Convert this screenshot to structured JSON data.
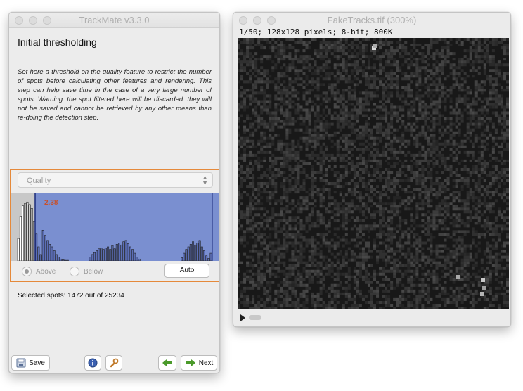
{
  "trackmate": {
    "title": "TrackMate v3.3.0",
    "heading": "Initial thresholding",
    "description": "Set here a threshold on the quality feature to restrict the number of spots before calculating other features and rendering. This step can help save time in the case of a very large number of spots.",
    "warning": "Warning: the spot filtered here will be discarded: they will not be saved and cannot be retrieved by any other means than re-doing the detection step.",
    "feature_select": {
      "value": "Quality",
      "icon": "chevron-updown-icon"
    },
    "histogram": {
      "threshold_label": "2.38",
      "threshold_color": "#c8502a",
      "fill_color": "#7a8fd0",
      "threshold_fraction": 0.1,
      "bar_heights": [
        0.35,
        0.7,
        0.86,
        0.9,
        0.92,
        0.88,
        0.82,
        0.62,
        0.42,
        0.22,
        0.1,
        0.48,
        0.4,
        0.32,
        0.26,
        0.22,
        0.16,
        0.1,
        0.06,
        0.03,
        0.02,
        0.01,
        0.01,
        0,
        0,
        0,
        0,
        0,
        0,
        0,
        0,
        0,
        0.06,
        0.1,
        0.13,
        0.16,
        0.19,
        0.2,
        0.18,
        0.2,
        0.22,
        0.18,
        0.24,
        0.19,
        0.26,
        0.28,
        0.25,
        0.3,
        0.32,
        0.27,
        0.22,
        0.18,
        0.12,
        0.06,
        0.03,
        0,
        0,
        0,
        0,
        0,
        0,
        0,
        0,
        0,
        0,
        0,
        0,
        0,
        0,
        0,
        0,
        0,
        0,
        0.05,
        0.12,
        0.18,
        0.22,
        0.26,
        0.3,
        0.25,
        0.28,
        0.32,
        0.22,
        0.16,
        0.08,
        0.04,
        0.12
      ]
    },
    "radio_above": "Above",
    "radio_below": "Below",
    "auto_label": "Auto",
    "selected_spots": "Selected spots: 1472 out of 25234",
    "buttons": {
      "save": "Save",
      "next": "Next",
      "save_icon": "save-icon",
      "info_icon": "info-icon",
      "wrench_icon": "wrench-icon",
      "prev_icon": "arrow-left-icon",
      "next_icon": "arrow-right-icon"
    }
  },
  "image_window": {
    "title": "FakeTracks.tif (300%)",
    "info": "1/50; 128x128 pixels; 8-bit; 800K",
    "slice_scrollbar": "play-icon"
  }
}
